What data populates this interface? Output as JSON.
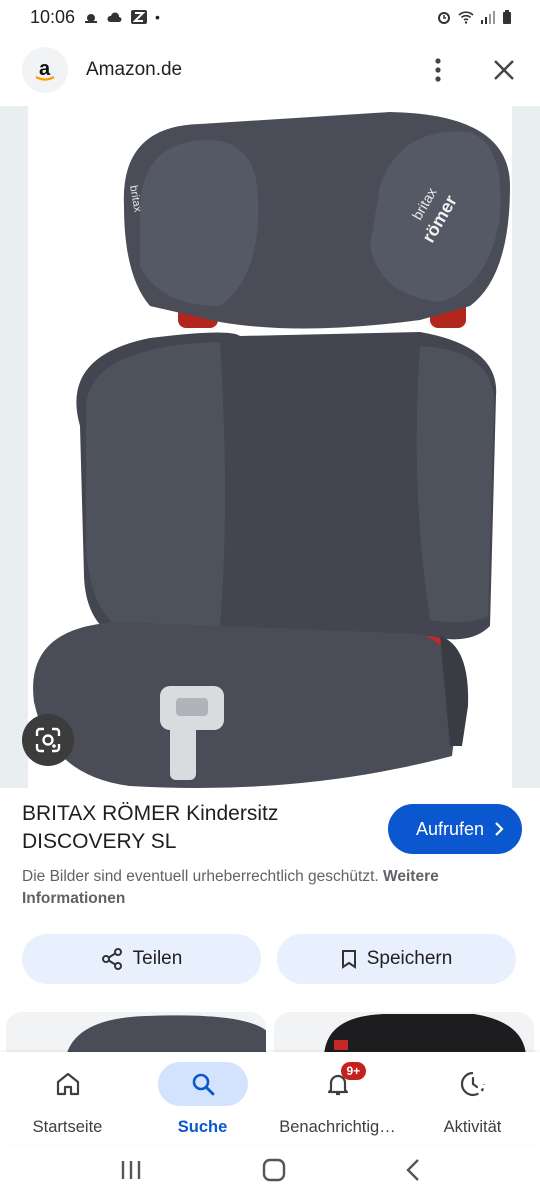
{
  "status": {
    "time": "10:06"
  },
  "header": {
    "site_name": "Amazon.de",
    "favicon_letter": "a"
  },
  "image": {
    "brand_text_1": "britax",
    "brand_text_2": "römer"
  },
  "product": {
    "title": "BRITAX RÖMER Kindersitz DISCOVERY SL",
    "visit_label": "Aufrufen",
    "disclaimer": "Die Bilder sind eventuell urheberrechtlich geschützt.",
    "disclaimer_link": "Weitere Informationen"
  },
  "actions": {
    "share_label": "Teilen",
    "save_label": "Speichern"
  },
  "bottom_nav": {
    "items": [
      {
        "label": "Startseite",
        "icon": "home-icon"
      },
      {
        "label": "Suche",
        "icon": "search-icon",
        "active": true
      },
      {
        "label": "Benachrichtig…",
        "icon": "bell-icon",
        "badge": "9+"
      },
      {
        "label": "Aktivität",
        "icon": "activity-icon"
      }
    ]
  },
  "colors": {
    "accent": "#0b57d0",
    "pill_bg": "#e8f0fe",
    "badge": "#c5221f",
    "seat": "#4a4d57"
  }
}
